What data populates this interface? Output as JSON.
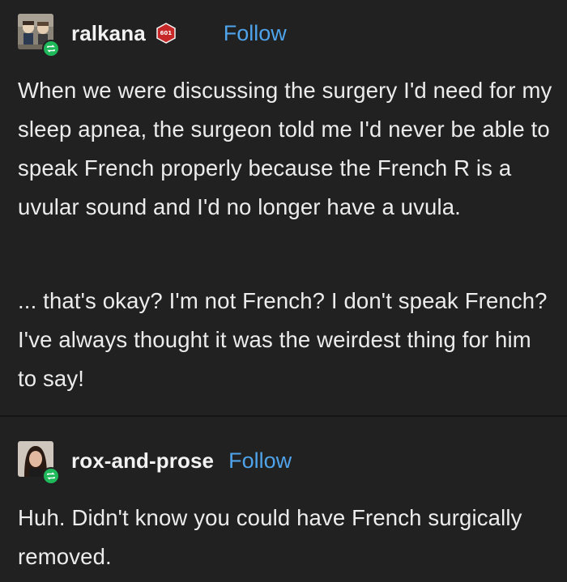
{
  "posts": [
    {
      "username": "ralkana",
      "badge_text": "601",
      "follow_label": "Follow",
      "avatar_icon": "figurine-avatar",
      "reblog_icon": "reblog-icon",
      "paragraphs": [
        "When we were discussing the surgery I'd need for my sleep apnea, the surgeon told me I'd never be able to speak French properly because the French R is a uvular sound and I'd no longer have a uvula.",
        "... that's okay? I'm not French? I don't speak French? I've always thought it was the weirdest thing for him to say!"
      ]
    },
    {
      "username": "rox-and-prose",
      "follow_label": "Follow",
      "avatar_icon": "portrait-avatar",
      "reblog_icon": "reblog-icon",
      "paragraphs": [
        "Huh. Didn't know you could have French surgically removed."
      ]
    }
  ],
  "colors": {
    "background": "#212121",
    "text": "#ececec",
    "follow": "#4fa3ea",
    "reblog_badge": "#1fb85a",
    "mod_badge": "#c62828"
  }
}
